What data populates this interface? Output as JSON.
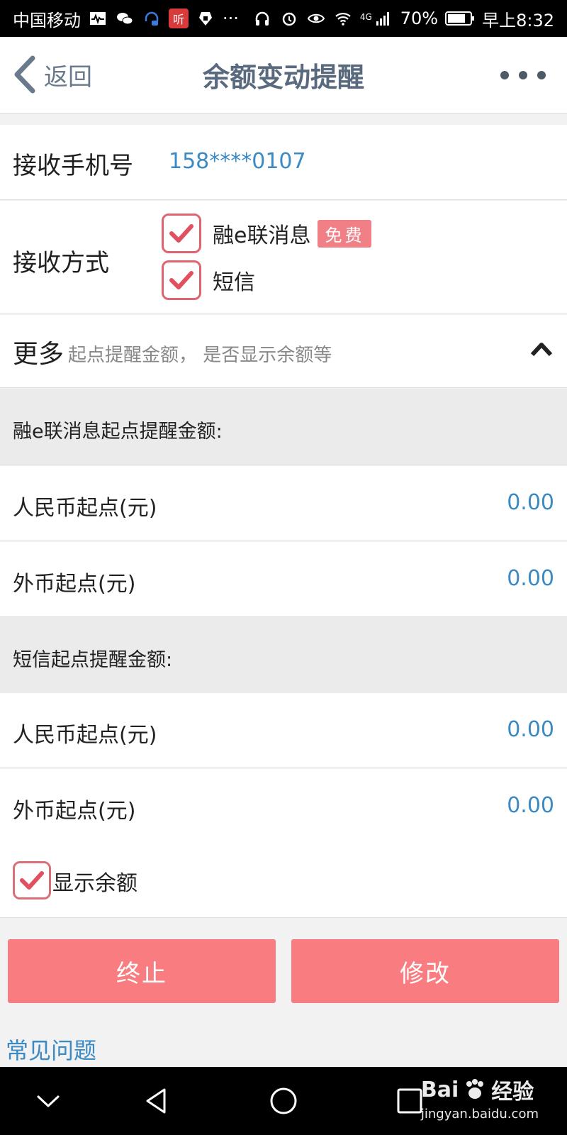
{
  "status_bar": {
    "carrier": "中国移动",
    "net_type": "4G",
    "battery": "70%",
    "time": "早上8:32"
  },
  "header": {
    "back_label": "返回",
    "title": "余额变动提醒"
  },
  "phone": {
    "label": "接收手机号",
    "value": "158****0107"
  },
  "method": {
    "label": "接收方式",
    "options": [
      {
        "label": "融e联消息",
        "badge": "免费",
        "checked": true
      },
      {
        "label": "短信",
        "checked": true
      }
    ]
  },
  "more": {
    "title": "更多",
    "description": "起点提醒金额， 是否显示余额等",
    "expanded": true
  },
  "sections": [
    {
      "title": "融e联消息起点提醒金额:",
      "rows": [
        {
          "label": "人民币起点(元)",
          "value": "0.00"
        },
        {
          "label": "外币起点(元)",
          "value": "0.00"
        }
      ]
    },
    {
      "title": "短信起点提醒金额:",
      "rows": [
        {
          "label": "人民币起点(元)",
          "value": "0.00"
        },
        {
          "label": "外币起点(元)",
          "value": "0.00"
        }
      ]
    }
  ],
  "show_balance": {
    "label": "显示余额",
    "checked": true
  },
  "buttons": {
    "stop": "终止",
    "edit": "修改"
  },
  "faq_link": "常见问题",
  "watermark": {
    "brand": "Bai",
    "brand_cn": "经验",
    "url": "jingyan.baidu.com"
  },
  "colors": {
    "accent_blue": "#3b8ac4",
    "button_red": "#f97d80",
    "check_red": "#e06470"
  }
}
